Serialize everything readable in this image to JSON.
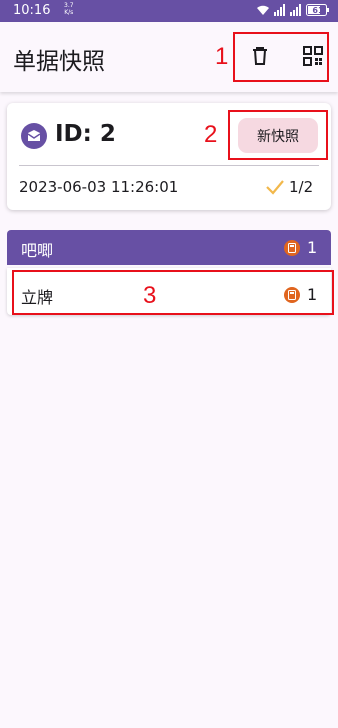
{
  "status_bar": {
    "time": "10:16",
    "net_speed": "3.7",
    "net_unit": "K/s",
    "battery": "61"
  },
  "appbar": {
    "title": "单据快照"
  },
  "annotations": [
    "1",
    "2",
    "3"
  ],
  "doc_card": {
    "id_label": "ID: 2",
    "new_snapshot_label": "新快照",
    "datetime": "2023-06-03 11:26:01",
    "progress": "1/2"
  },
  "group": {
    "name": "吧唧",
    "count": "1"
  },
  "items": [
    {
      "name": "立牌",
      "count": "1"
    }
  ],
  "colors": {
    "primary": "#6750a4",
    "annotation": "#e8101b",
    "calc_badge": "#e0651f",
    "check": "#f2b84b",
    "button_bg": "#f6d9e1"
  }
}
